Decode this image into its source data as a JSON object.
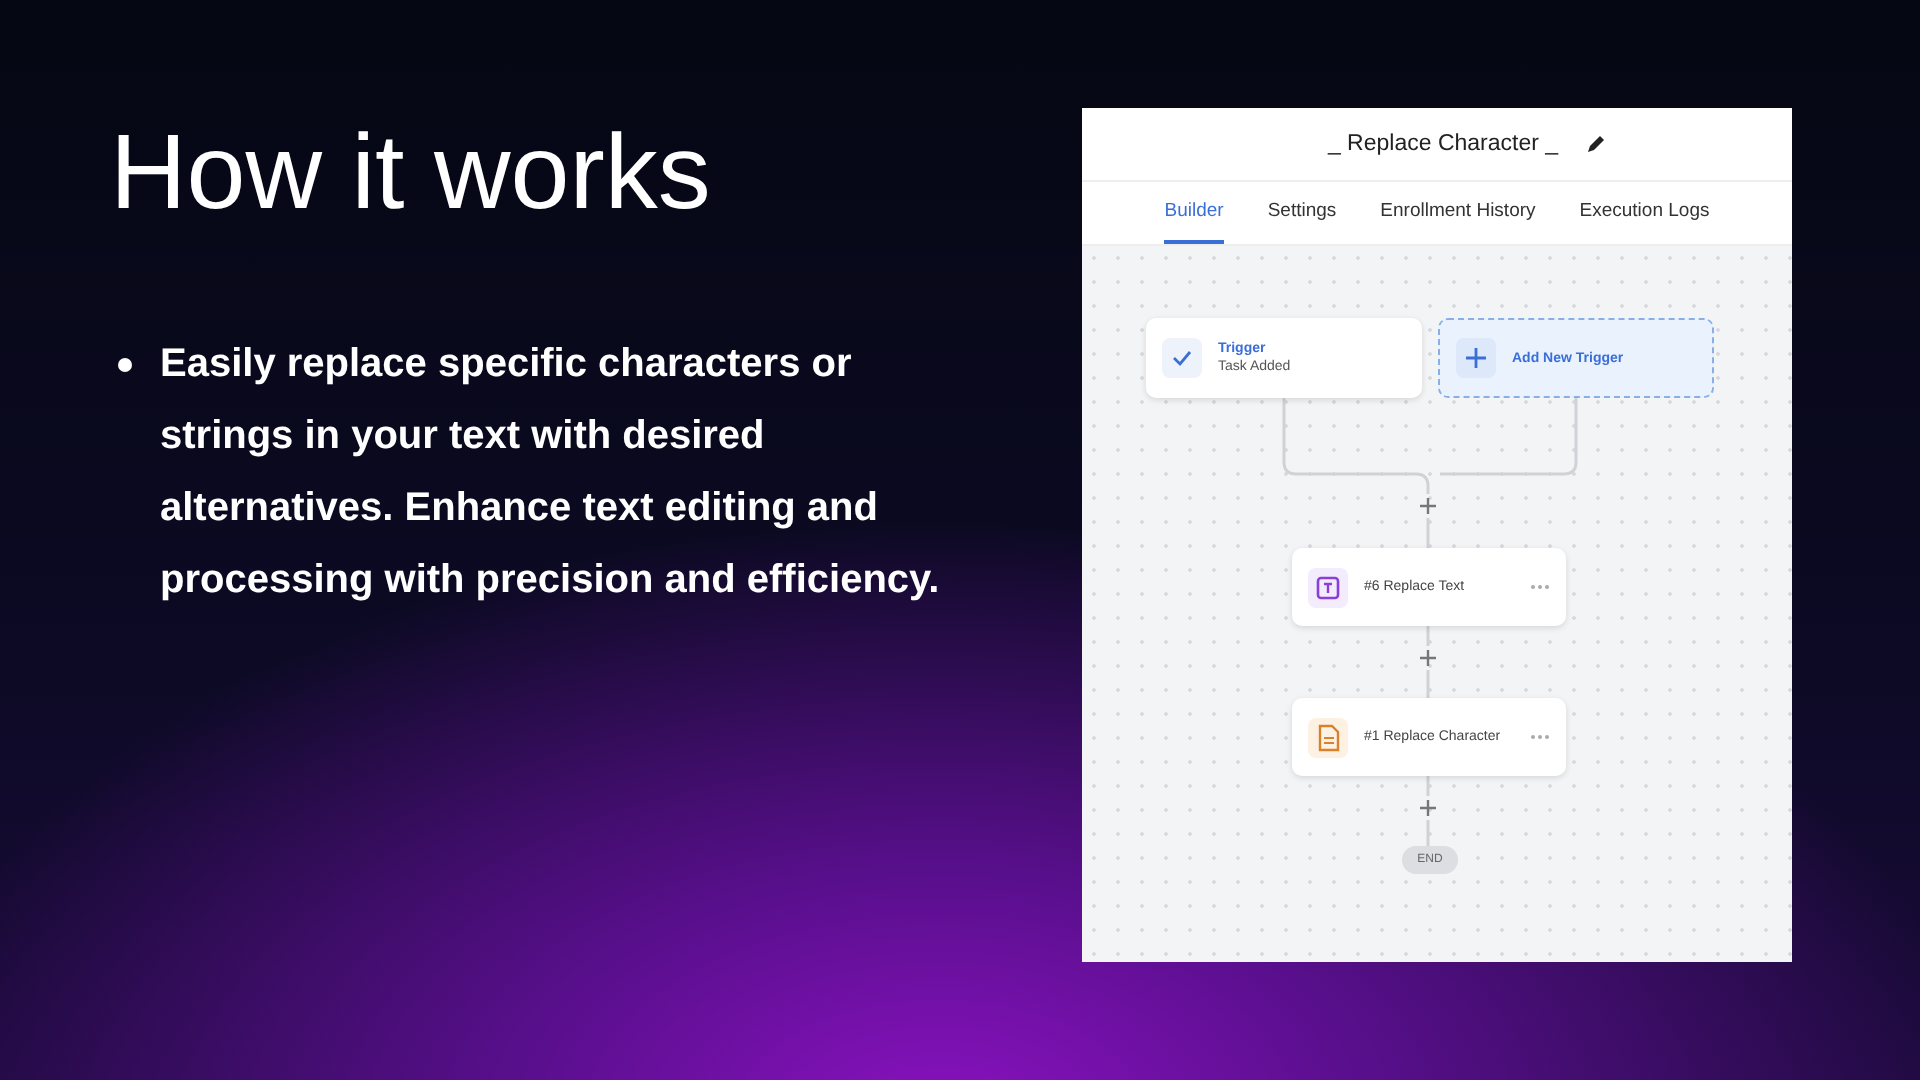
{
  "slide": {
    "title": "How it works",
    "bullets": [
      "Easily replace specific characters or strings in your text with desired alternatives. Enhance text editing and processing with precision and efficiency."
    ]
  },
  "app": {
    "title": "_ Replace Character _",
    "tabs": [
      {
        "label": "Builder",
        "selected": true
      },
      {
        "label": "Settings",
        "selected": false
      },
      {
        "label": "Enrollment History",
        "selected": false
      },
      {
        "label": "Execution Logs",
        "selected": false
      }
    ],
    "trigger": {
      "title": "Trigger",
      "subtitle": "Task Added"
    },
    "add_trigger": {
      "label": "Add New Trigger"
    },
    "steps": [
      {
        "label": "#6 Replace Text",
        "kind": "text"
      },
      {
        "label": "#1 Replace Character",
        "kind": "document"
      }
    ],
    "end": {
      "label": "END"
    }
  }
}
